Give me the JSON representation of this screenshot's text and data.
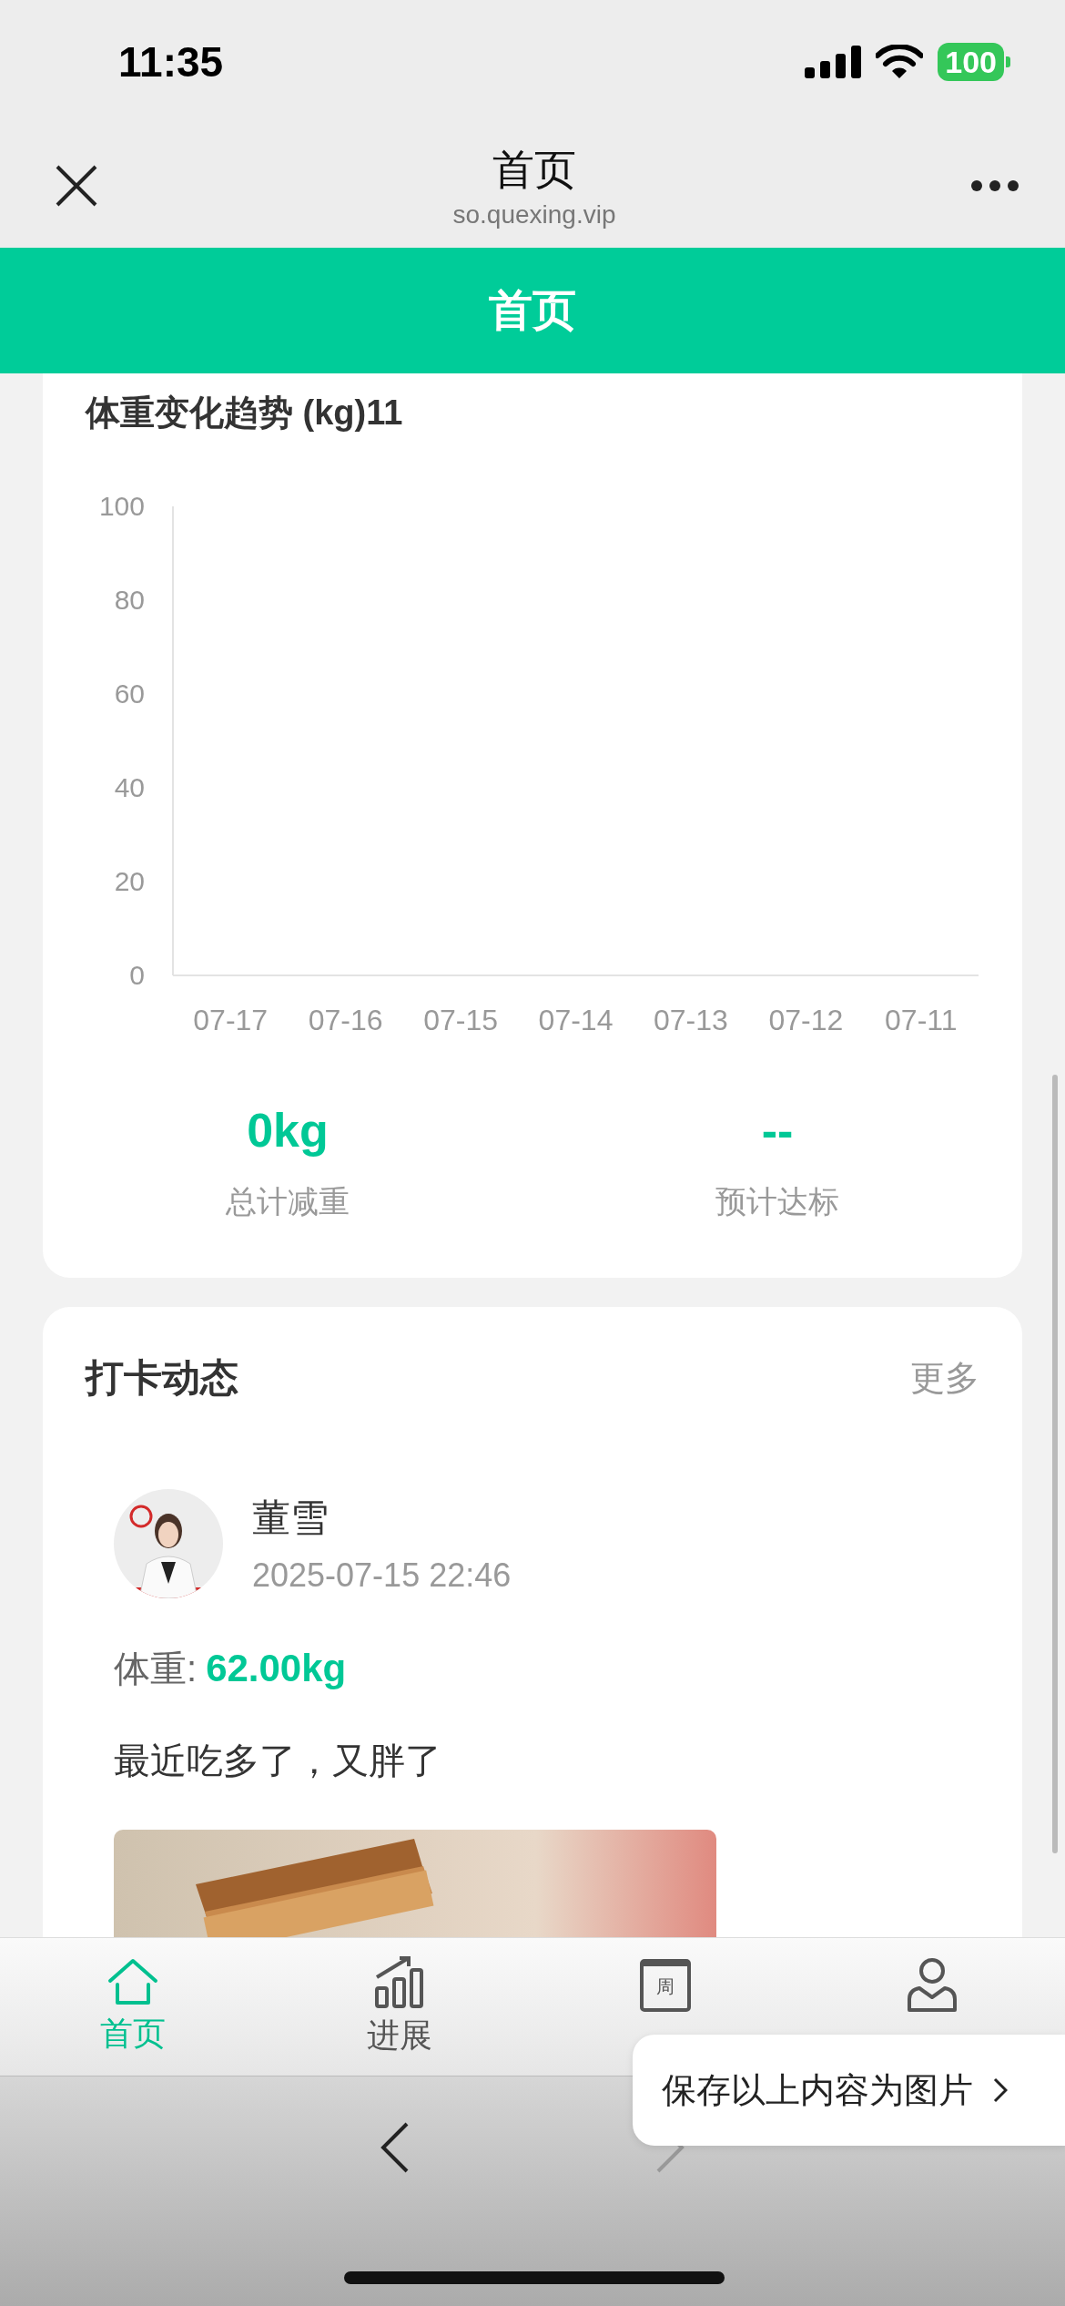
{
  "status_bar": {
    "time": "11:35",
    "battery": "100"
  },
  "nav_bar": {
    "title": "首页",
    "url": "so.quexing.vip"
  },
  "header": {
    "title": "首页"
  },
  "weight_card": {
    "title": "体重变化趋势 (kg)11",
    "chart_data": {
      "type": "line",
      "categories": [
        "07-17",
        "07-16",
        "07-15",
        "07-14",
        "07-13",
        "07-12",
        "07-11"
      ],
      "values": [
        null,
        null,
        null,
        null,
        null,
        null,
        null
      ],
      "ylim": [
        0,
        100
      ],
      "yticks": [
        0,
        20,
        40,
        60,
        80,
        100
      ]
    },
    "stats": [
      {
        "value": "0kg",
        "label": "总计减重"
      },
      {
        "value": "--",
        "label": "预计达标"
      }
    ]
  },
  "checkins": {
    "title": "打卡动态",
    "more": "更多",
    "posts": [
      {
        "name": "董雪",
        "time": "2025-07-15 22:46",
        "weight_label": "体重:",
        "weight": "62.00kg",
        "text": "最近吃多了，又胖了"
      }
    ]
  },
  "tab_bar": [
    {
      "kind": "home",
      "label": "首页",
      "selected": true
    },
    {
      "kind": "chart",
      "label": "进展",
      "selected": false
    },
    {
      "kind": "calendar",
      "icon_text": "周",
      "selected": false
    },
    {
      "kind": "user",
      "selected": false
    }
  ],
  "popup": {
    "text": "保存以上内容为图片"
  }
}
